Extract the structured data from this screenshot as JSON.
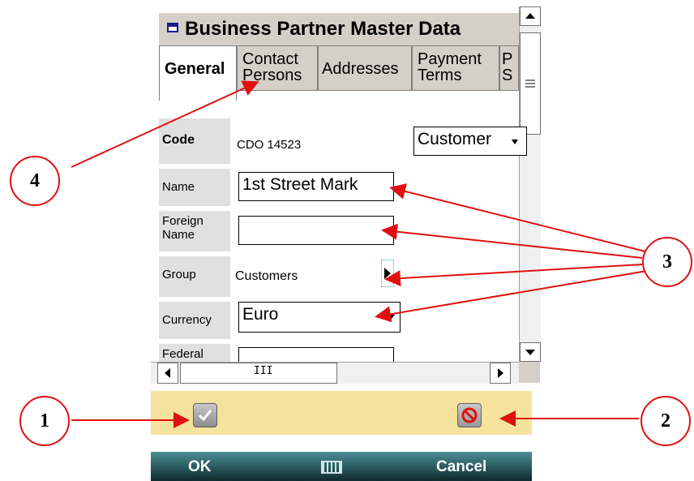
{
  "window": {
    "title": "Business Partner Master Data"
  },
  "tabs": [
    {
      "label": "General",
      "active": true
    },
    {
      "label": "Contact Persons",
      "active": false
    },
    {
      "label": "Addresses",
      "active": false
    },
    {
      "label": "Payment Terms",
      "active": false
    },
    {
      "label": "P S",
      "active": false
    }
  ],
  "form": {
    "code_label": "Code",
    "code_value": "CDO 14523",
    "type_value": "Customer",
    "name_label": "Name",
    "name_value": "1st Street Mark",
    "foreign_name_label": "Foreign Name",
    "foreign_name_value": "",
    "group_label": "Group",
    "group_value": "Customers",
    "currency_label": "Currency",
    "currency_value": "Euro",
    "federal_label": "Federal",
    "federal_value": ""
  },
  "hscroll": {
    "thumb_glyph": "III"
  },
  "softkeys": {
    "left": "OK",
    "right": "Cancel"
  },
  "callouts": [
    "1",
    "2",
    "3",
    "4"
  ],
  "colors": {
    "callout_red": "#e01010",
    "action_bar": "#f5e29c",
    "softkey_bg": "#1c4a50"
  },
  "icons": {
    "ok": "checkmark-icon",
    "cancel": "cancel-icon",
    "keyboard": "keyboard-icon"
  }
}
